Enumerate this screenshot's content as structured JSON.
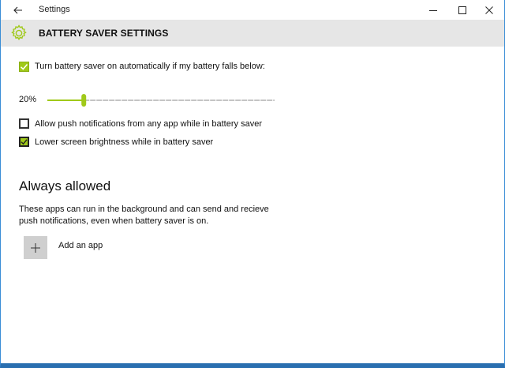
{
  "window": {
    "title": "Settings",
    "back_icon": "arrow-left-icon",
    "controls": [
      "minimize-icon",
      "maximize-icon",
      "close-icon"
    ]
  },
  "header": {
    "icon": "gear-icon",
    "title": "BATTERY SAVER SETTINGS"
  },
  "settings": {
    "auto_on": {
      "label": "Turn battery saver on automatically if my battery falls below:",
      "checked": true
    },
    "threshold": {
      "value_label": "20%",
      "value_percent": 20
    },
    "push_notifications": {
      "label": "Allow push notifications from any app while in battery saver",
      "checked": false
    },
    "lower_brightness": {
      "label": "Lower screen brightness while in battery saver",
      "checked": true
    }
  },
  "always_allowed": {
    "title": "Always allowed",
    "description": "These apps can run in the background and can send and recieve push notifications, even when battery saver is on.",
    "add_label": "Add an app",
    "add_icon": "plus-icon"
  },
  "colors": {
    "accent": "#a0c91a",
    "header_bg": "#e6e6e6",
    "window_border": "#3a8dd6"
  }
}
